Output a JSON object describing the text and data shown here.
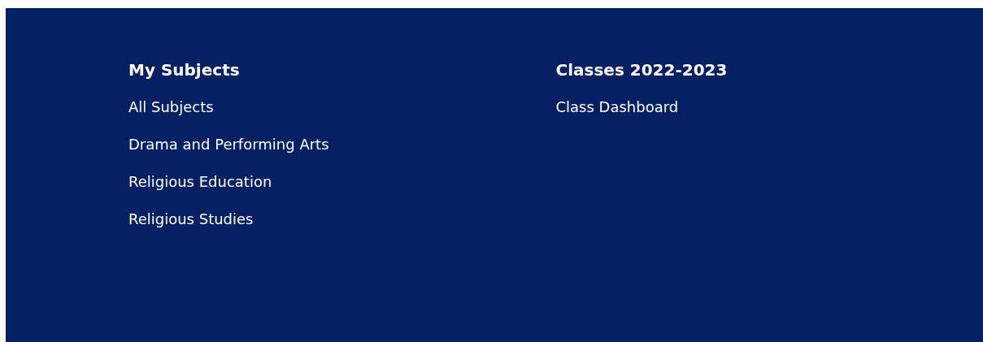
{
  "columns": [
    {
      "heading": "My Subjects",
      "links": [
        "All Subjects",
        "Drama and Performing Arts",
        "Religious Education",
        "Religious Studies"
      ]
    },
    {
      "heading": "Classes 2022-2023",
      "links": [
        "Class Dashboard"
      ]
    }
  ]
}
